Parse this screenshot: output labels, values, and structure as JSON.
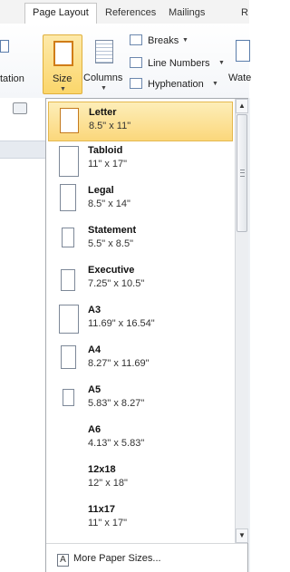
{
  "ribbon": {
    "tabs": [
      "Page Layout",
      "References",
      "Mailings",
      "R"
    ],
    "buttons": {
      "orientation": "tation",
      "size": "Size",
      "columns": "Columns",
      "breaks": "Breaks",
      "line_numbers": "Line Numbers",
      "hyphenation": "Hyphenation",
      "watermark": "Wate"
    }
  },
  "menu": {
    "items": [
      {
        "name": "Letter",
        "dims": "8.5\" x 11\"",
        "selected": true
      },
      {
        "name": "Tabloid",
        "dims": "11\" x 17\""
      },
      {
        "name": "Legal",
        "dims": "8.5\" x 14\""
      },
      {
        "name": "Statement",
        "dims": "5.5\" x 8.5\""
      },
      {
        "name": "Executive",
        "dims": "7.25\" x 10.5\""
      },
      {
        "name": "A3",
        "dims": "11.69\" x 16.54\""
      },
      {
        "name": "A4",
        "dims": "8.27\" x 11.69\""
      },
      {
        "name": "A5",
        "dims": "5.83\" x 8.27\""
      },
      {
        "name": "A6",
        "dims": "4.13\" x 5.83\""
      },
      {
        "name": "12x18",
        "dims": "12\" x 18\""
      },
      {
        "name": "11x17",
        "dims": "11\" x 17\""
      }
    ],
    "more_label": "More Paper Sizes...",
    "more_icon_glyph": "A"
  }
}
